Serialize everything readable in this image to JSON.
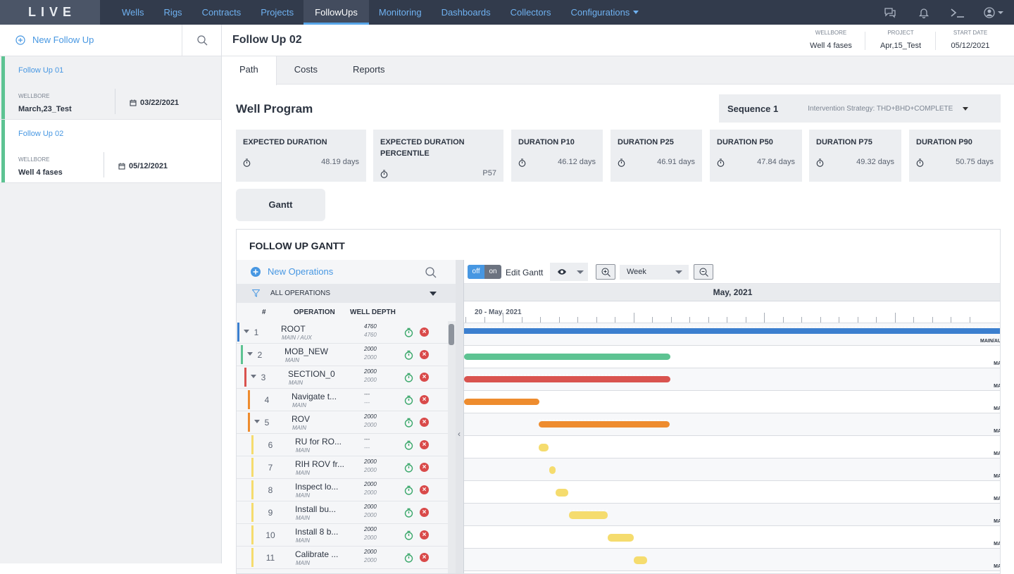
{
  "brand": "LIVE",
  "nav": {
    "items": [
      "Wells",
      "Rigs",
      "Contracts",
      "Projects",
      "FollowUps",
      "Monitoring",
      "Dashboards",
      "Collectors",
      "Configurations"
    ],
    "active": "FollowUps"
  },
  "topbar_icons": [
    "chat-icon",
    "bell-icon",
    "terminal-icon",
    "user-icon"
  ],
  "sidebar": {
    "new_label": "New Follow Up",
    "followups": [
      {
        "title": "Follow Up 01",
        "wellbore_label": "WELLBORE",
        "wellbore": "March,23_Test",
        "date": "03/22/2021"
      },
      {
        "title": "Follow Up 02",
        "wellbore_label": "WELLBORE",
        "wellbore": "Well 4 fases",
        "date": "05/12/2021"
      }
    ]
  },
  "header": {
    "title": "Follow Up 02",
    "wellbore_label": "WELLBORE",
    "wellbore": "Well 4 fases",
    "project_label": "PROJECT",
    "project": "Apr,15_Test",
    "start_label": "START DATE",
    "start": "05/12/2021"
  },
  "tabs": [
    "Path",
    "Costs",
    "Reports"
  ],
  "well_program": {
    "title": "Well Program",
    "sequence": "Sequence 1",
    "strategy": "Intervention Strategy: THD+BHD+COMPLETE",
    "cards": [
      {
        "title": "EXPECTED DURATION",
        "value": "48.19 days"
      },
      {
        "title": "EXPECTED DURATION PERCENTILE",
        "value": "P57"
      },
      {
        "title": "DURATION P10",
        "value": "46.12 days"
      },
      {
        "title": "DURATION P25",
        "value": "46.91 days"
      },
      {
        "title": "DURATION P50",
        "value": "47.84 days"
      },
      {
        "title": "DURATION P75",
        "value": "49.32 days"
      },
      {
        "title": "DURATION P90",
        "value": "50.75 days"
      }
    ],
    "gantt_button": "Gantt"
  },
  "gantt": {
    "title": "FOLLOW UP GANTT",
    "new_operations": "New Operations",
    "filter": "ALL OPERATIONS",
    "cols": {
      "num": "#",
      "op": "OPERATION",
      "depth": "WELL DEPTH"
    },
    "toggle_off": "off",
    "toggle_on": "on",
    "edit_label": "Edit Gantt",
    "scale": "Week",
    "month": "May, 2021",
    "week_label": "20 - May, 2021",
    "rows": [
      {
        "num": "1",
        "name": "ROOT",
        "sub": "MAIN / AUX",
        "d1": "4760",
        "d2": "4760",
        "color": "#3b7fcf",
        "bar": "MAIN/AU"
      },
      {
        "num": "2",
        "name": "MOB_NEW",
        "sub": "MAIN",
        "d1": "2000",
        "d2": "2000",
        "color": "#5dc392",
        "bar": "MA"
      },
      {
        "num": "3",
        "name": "SECTION_0",
        "sub": "MAIN",
        "d1": "2000",
        "d2": "2000",
        "color": "#d9534f",
        "bar": "MA"
      },
      {
        "num": "4",
        "name": "Navigate t...",
        "sub": "MAIN",
        "d1": "---",
        "d2": "---",
        "color": "#ee8c2e",
        "bar": "MA"
      },
      {
        "num": "5",
        "name": "ROV",
        "sub": "MAIN",
        "d1": "2000",
        "d2": "2000",
        "color": "#ee8c2e",
        "bar": "MA"
      },
      {
        "num": "6",
        "name": "RU for RO...",
        "sub": "MAIN",
        "d1": "---",
        "d2": "---",
        "color": "#f5dc6e",
        "bar": "MA"
      },
      {
        "num": "7",
        "name": "RIH ROV fr...",
        "sub": "MAIN",
        "d1": "2000",
        "d2": "2000",
        "color": "#f5dc6e",
        "bar": "MA"
      },
      {
        "num": "8",
        "name": "Inspect lo...",
        "sub": "MAIN",
        "d1": "2000",
        "d2": "2000",
        "color": "#f5dc6e",
        "bar": "MA"
      },
      {
        "num": "9",
        "name": "Install bu...",
        "sub": "MAIN",
        "d1": "2000",
        "d2": "2000",
        "color": "#f5dc6e",
        "bar": "MA"
      },
      {
        "num": "10",
        "name": "Install 8 b...",
        "sub": "MAIN",
        "d1": "2000",
        "d2": "2000",
        "color": "#f5dc6e",
        "bar": "MA"
      },
      {
        "num": "11",
        "name": "Calibrate ...",
        "sub": "MAIN",
        "d1": "2000",
        "d2": "2000",
        "color": "#f5dc6e",
        "bar": "MA"
      }
    ]
  }
}
